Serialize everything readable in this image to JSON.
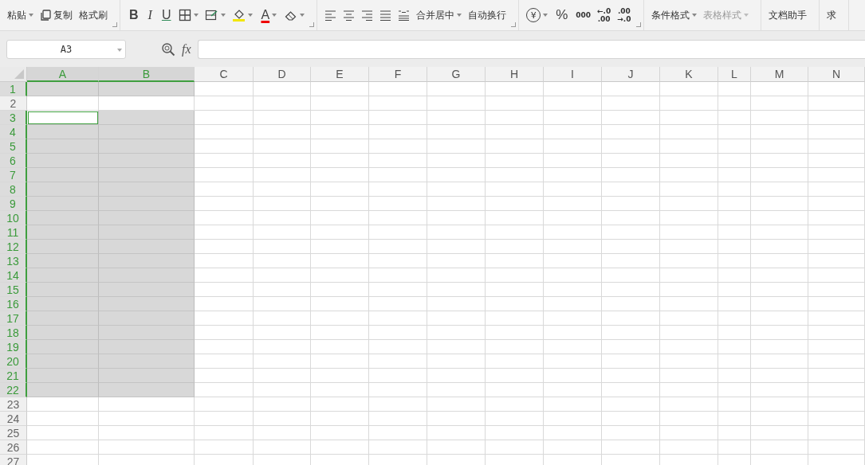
{
  "toolbar": {
    "groups": [
      {
        "launcher": true,
        "items": [
          {
            "kind": "button",
            "label": "粘贴",
            "dropdown": true,
            "disabled": false
          },
          {
            "kind": "copy",
            "label": "复制",
            "dropdown": false,
            "disabled": false
          },
          {
            "kind": "button",
            "label": "格式刷",
            "dropdown": false,
            "disabled": false
          }
        ]
      },
      {
        "launcher": true,
        "items": [
          {
            "kind": "bold",
            "label": "B",
            "dropdown": false,
            "disabled": false
          },
          {
            "kind": "italic",
            "label": "I",
            "dropdown": false,
            "disabled": false
          },
          {
            "kind": "underline",
            "label": "U",
            "dropdown": false,
            "disabled": false
          },
          {
            "kind": "borders",
            "dropdown": true,
            "disabled": false
          },
          {
            "kind": "cellstyle",
            "dropdown": true,
            "disabled": false
          },
          {
            "kind": "fillcolor",
            "dropdown": true,
            "disabled": false
          },
          {
            "kind": "fontcolor",
            "label": "A",
            "dropdown": true,
            "disabled": false
          },
          {
            "kind": "eraser",
            "dropdown": true,
            "disabled": false
          }
        ]
      },
      {
        "launcher": true,
        "items": [
          {
            "kind": "alignleft",
            "dropdown": false,
            "disabled": false
          },
          {
            "kind": "aligncenter",
            "dropdown": false,
            "disabled": false
          },
          {
            "kind": "alignright",
            "dropdown": false,
            "disabled": false
          },
          {
            "kind": "justify",
            "dropdown": false,
            "disabled": false
          },
          {
            "kind": "distribute",
            "dropdown": false,
            "disabled": false
          },
          {
            "kind": "button",
            "label": "合并居中",
            "dropdown": true,
            "disabled": false
          },
          {
            "kind": "button",
            "label": "自动换行",
            "dropdown": false,
            "disabled": false
          }
        ]
      },
      {
        "launcher": true,
        "items": [
          {
            "kind": "currency",
            "label": "¥",
            "dropdown": true,
            "disabled": false
          },
          {
            "kind": "percent",
            "label": "%",
            "dropdown": false,
            "disabled": false
          },
          {
            "kind": "thousands",
            "label": "000",
            "dropdown": false,
            "disabled": false
          },
          {
            "kind": "decimals",
            "lines": [
              "←.0",
              ".00"
            ],
            "dropdown": false,
            "disabled": false
          },
          {
            "kind": "decimals",
            "lines": [
              ".00",
              "→.0"
            ],
            "dropdown": false,
            "disabled": false
          }
        ]
      },
      {
        "launcher": false,
        "items": [
          {
            "kind": "button",
            "label": "条件格式",
            "dropdown": true,
            "disabled": false
          },
          {
            "kind": "button",
            "label": "表格样式",
            "dropdown": true,
            "disabled": true
          }
        ]
      },
      {
        "launcher": false,
        "items": [
          {
            "kind": "button",
            "label": "文档助手",
            "dropdown": false,
            "disabled": false
          }
        ]
      },
      {
        "launcher": false,
        "items": [
          {
            "kind": "button",
            "label": "求",
            "dropdown": false,
            "disabled": false
          }
        ]
      }
    ]
  },
  "name_box": {
    "value": "A3"
  },
  "formula_bar": {
    "fx": "fx"
  },
  "columns": [
    {
      "label": "A",
      "selected": true
    },
    {
      "label": "B",
      "selected": true
    },
    {
      "label": "C",
      "selected": false
    },
    {
      "label": "D",
      "selected": false
    },
    {
      "label": "E",
      "selected": false
    },
    {
      "label": "F",
      "selected": false
    },
    {
      "label": "G",
      "selected": false
    },
    {
      "label": "H",
      "selected": false
    },
    {
      "label": "I",
      "selected": false
    },
    {
      "label": "J",
      "selected": false
    },
    {
      "label": "K",
      "selected": false
    },
    {
      "label": "L",
      "selected": false
    },
    {
      "label": "M",
      "selected": false
    },
    {
      "label": "N",
      "selected": false
    }
  ],
  "rows": [
    {
      "label": "1",
      "selected": true,
      "active": false
    },
    {
      "label": "2",
      "selected": false,
      "active": false
    },
    {
      "label": "3",
      "selected": true,
      "active": true
    },
    {
      "label": "4",
      "selected": true,
      "active": false
    },
    {
      "label": "5",
      "selected": true,
      "active": false
    },
    {
      "label": "6",
      "selected": true,
      "active": false
    },
    {
      "label": "7",
      "selected": true,
      "active": false
    },
    {
      "label": "8",
      "selected": true,
      "active": false
    },
    {
      "label": "9",
      "selected": true,
      "active": false
    },
    {
      "label": "10",
      "selected": true,
      "active": false
    },
    {
      "label": "11",
      "selected": true,
      "active": false
    },
    {
      "label": "12",
      "selected": true,
      "active": false
    },
    {
      "label": "13",
      "selected": true,
      "active": false
    },
    {
      "label": "14",
      "selected": true,
      "active": false
    },
    {
      "label": "15",
      "selected": true,
      "active": false
    },
    {
      "label": "16",
      "selected": true,
      "active": false
    },
    {
      "label": "17",
      "selected": true,
      "active": false
    },
    {
      "label": "18",
      "selected": true,
      "active": false
    },
    {
      "label": "19",
      "selected": true,
      "active": false
    },
    {
      "label": "20",
      "selected": true,
      "active": false
    },
    {
      "label": "21",
      "selected": true,
      "active": false
    },
    {
      "label": "22",
      "selected": true,
      "active": false
    },
    {
      "label": "23",
      "selected": false,
      "active": false
    },
    {
      "label": "24",
      "selected": false,
      "active": false
    },
    {
      "label": "25",
      "selected": false,
      "active": false
    },
    {
      "label": "26",
      "selected": false,
      "active": false
    },
    {
      "label": "27",
      "selected": false,
      "active": false
    }
  ]
}
